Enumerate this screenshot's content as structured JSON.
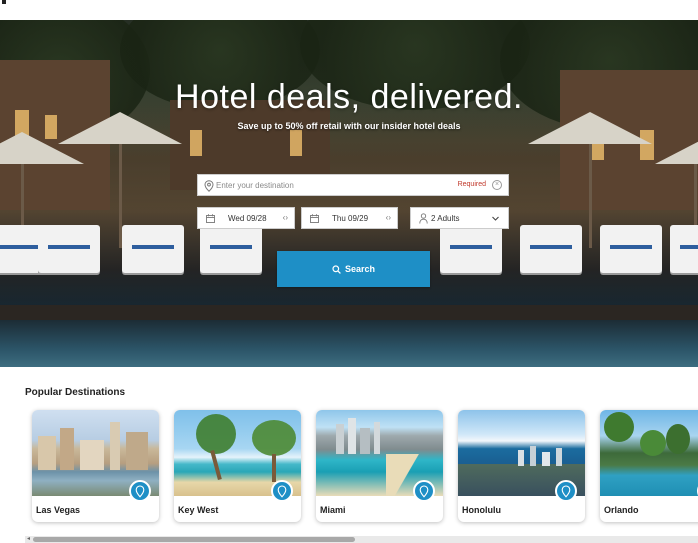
{
  "hero": {
    "title": "Hotel deals, delivered.",
    "subtitle": "Save up to 50% off retail with our insider hotel deals"
  },
  "search": {
    "destination_placeholder": "Enter your destination",
    "required_label": "Required",
    "checkin": "Wed 09/28",
    "checkout": "Thu 09/29",
    "guests": "2 Adults",
    "button_label": "Search"
  },
  "popular": {
    "title": "Popular Destinations",
    "destinations": [
      {
        "name": "Las Vegas"
      },
      {
        "name": "Key West"
      },
      {
        "name": "Miami"
      },
      {
        "name": "Honolulu"
      },
      {
        "name": "Orlando"
      }
    ]
  },
  "colors": {
    "accent": "#1e8fc6",
    "required": "#c0392b"
  },
  "icons": {
    "destination": "map-pin-icon",
    "clear": "clear-icon",
    "calendar": "calendar-icon",
    "date_arrows": "left-right-arrows-icon",
    "guests": "person-icon",
    "dropdown": "chevron-down-icon",
    "search": "search-icon",
    "card_pin": "location-pin-icon"
  }
}
